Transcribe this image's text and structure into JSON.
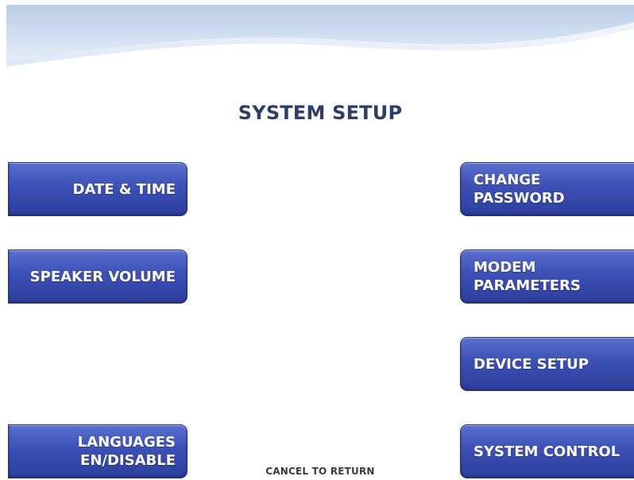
{
  "screen": {
    "title": "SYSTEM SETUP",
    "footer": "CANCEL TO RETURN"
  },
  "left_buttons": [
    {
      "label": "DATE & TIME"
    },
    {
      "label": "SPEAKER VOLUME"
    },
    {
      "label": "LANGUAGES\nEN/DISABLE"
    }
  ],
  "right_buttons": [
    {
      "label": "CHANGE\nPASSWORD"
    },
    {
      "label": "MODEM\nPARAMETERS"
    },
    {
      "label": "DEVICE SETUP"
    },
    {
      "label": "SYSTEM CONTROL"
    }
  ],
  "colors": {
    "button_blue": "#3c50b6",
    "title_navy": "#2c3e6e",
    "header_wave": "#c9d9ee"
  }
}
